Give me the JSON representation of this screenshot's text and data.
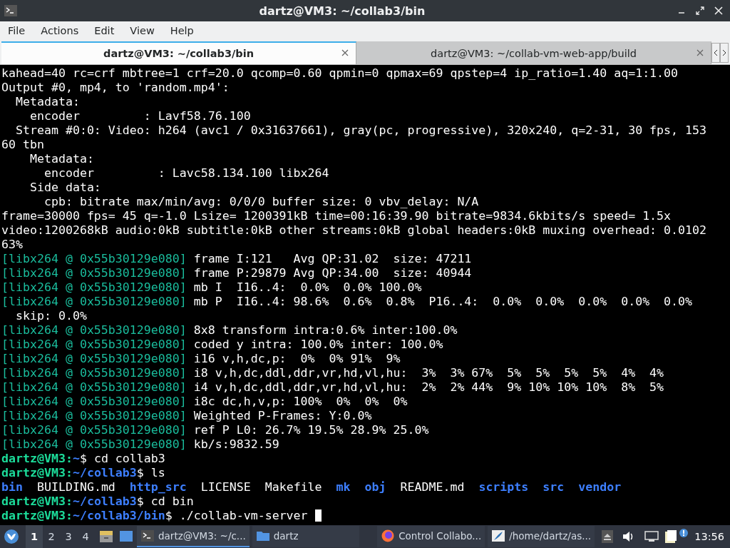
{
  "window": {
    "title": "dartz@VM3: ~/collab3/bin"
  },
  "menu": [
    "File",
    "Actions",
    "Edit",
    "View",
    "Help"
  ],
  "tabs": [
    {
      "label": "dartz@VM3: ~/collab3/bin",
      "selected": true
    },
    {
      "label": "dartz@VM3: ~/collab-vm-web-app/build",
      "selected": false
    }
  ],
  "terminal": {
    "lines": [
      [
        {
          "kind": "text",
          "text": "kahead=40 rc=crf mbtree=1 crf=20.0 qcomp=0.60 qpmin=0 qpmax=69 qpstep=4 ip_ratio=1.40 aq=1:1.00"
        }
      ],
      [
        {
          "kind": "text",
          "text": "Output #0, mp4, to 'random.mp4':"
        }
      ],
      [
        {
          "kind": "text",
          "text": "  Metadata:"
        }
      ],
      [
        {
          "kind": "text",
          "text": "    encoder         : Lavf58.76.100"
        }
      ],
      [
        {
          "kind": "text",
          "text": "  Stream #0:0: Video: h264 (avc1 / 0x31637661), gray(pc, progressive), 320x240, q=2-31, 30 fps, 153"
        }
      ],
      [
        {
          "kind": "text",
          "text": "60 tbn"
        }
      ],
      [
        {
          "kind": "text",
          "text": "    Metadata:"
        }
      ],
      [
        {
          "kind": "text",
          "text": "      encoder         : Lavc58.134.100 libx264"
        }
      ],
      [
        {
          "kind": "text",
          "text": "    Side data:"
        }
      ],
      [
        {
          "kind": "text",
          "text": "      cpb: bitrate max/min/avg: 0/0/0 buffer size: 0 vbv_delay: N/A"
        }
      ],
      [
        {
          "kind": "text",
          "text": "frame=30000 fps= 45 q=-1.0 Lsize= 1200391kB time=00:16:39.90 bitrate=9834.6kbits/s speed= 1.5x"
        }
      ],
      [
        {
          "kind": "text",
          "text": "video:1200268kB audio:0kB subtitle:0kB other streams:0kB global headers:0kB muxing overhead: 0.0102"
        }
      ],
      [
        {
          "kind": "text",
          "text": "63%"
        }
      ],
      [
        {
          "kind": "prefix",
          "text": "[libx264 @ 0x55b30129e080]"
        },
        {
          "kind": "text",
          "text": " frame I:121   Avg QP:31.02  size: 47211"
        }
      ],
      [
        {
          "kind": "prefix",
          "text": "[libx264 @ 0x55b30129e080]"
        },
        {
          "kind": "text",
          "text": " frame P:29879 Avg QP:34.00  size: 40944"
        }
      ],
      [
        {
          "kind": "prefix",
          "text": "[libx264 @ 0x55b30129e080]"
        },
        {
          "kind": "text",
          "text": " mb I  I16..4:  0.0%  0.0% 100.0%"
        }
      ],
      [
        {
          "kind": "prefix",
          "text": "[libx264 @ 0x55b30129e080]"
        },
        {
          "kind": "text",
          "text": " mb P  I16..4: 98.6%  0.6%  0.8%  P16..4:  0.0%  0.0%  0.0%  0.0%  0.0%"
        }
      ],
      [
        {
          "kind": "text",
          "text": "  skip: 0.0%"
        }
      ],
      [
        {
          "kind": "prefix",
          "text": "[libx264 @ 0x55b30129e080]"
        },
        {
          "kind": "text",
          "text": " 8x8 transform intra:0.6% inter:100.0%"
        }
      ],
      [
        {
          "kind": "prefix",
          "text": "[libx264 @ 0x55b30129e080]"
        },
        {
          "kind": "text",
          "text": " coded y intra: 100.0% inter: 100.0%"
        }
      ],
      [
        {
          "kind": "prefix",
          "text": "[libx264 @ 0x55b30129e080]"
        },
        {
          "kind": "text",
          "text": " i16 v,h,dc,p:  0%  0% 91%  9%"
        }
      ],
      [
        {
          "kind": "prefix",
          "text": "[libx264 @ 0x55b30129e080]"
        },
        {
          "kind": "text",
          "text": " i8 v,h,dc,ddl,ddr,vr,hd,vl,hu:  3%  3% 67%  5%  5%  5%  5%  4%  4%"
        }
      ],
      [
        {
          "kind": "prefix",
          "text": "[libx264 @ 0x55b30129e080]"
        },
        {
          "kind": "text",
          "text": " i4 v,h,dc,ddl,ddr,vr,hd,vl,hu:  2%  2% 44%  9% 10% 10% 10%  8%  5%"
        }
      ],
      [
        {
          "kind": "prefix",
          "text": "[libx264 @ 0x55b30129e080]"
        },
        {
          "kind": "text",
          "text": " i8c dc,h,v,p: 100%  0%  0%  0%"
        }
      ],
      [
        {
          "kind": "prefix",
          "text": "[libx264 @ 0x55b30129e080]"
        },
        {
          "kind": "text",
          "text": " Weighted P-Frames: Y:0.0%"
        }
      ],
      [
        {
          "kind": "prefix",
          "text": "[libx264 @ 0x55b30129e080]"
        },
        {
          "kind": "text",
          "text": " ref P L0: 26.7% 19.5% 28.9% 25.0%"
        }
      ],
      [
        {
          "kind": "prefix",
          "text": "[libx264 @ 0x55b30129e080]"
        },
        {
          "kind": "text",
          "text": " kb/s:9832.59"
        }
      ],
      [
        {
          "kind": "user",
          "text": "dartz@VM3:"
        },
        {
          "kind": "path",
          "text": "~"
        },
        {
          "kind": "text",
          "text": "$ cd collab3"
        }
      ],
      [
        {
          "kind": "user",
          "text": "dartz@VM3:"
        },
        {
          "kind": "path",
          "text": "~/collab3"
        },
        {
          "kind": "text",
          "text": "$ ls"
        }
      ],
      [
        {
          "kind": "dir",
          "text": "bin"
        },
        {
          "kind": "text",
          "text": "  BUILDING.md  "
        },
        {
          "kind": "dir",
          "text": "http_src"
        },
        {
          "kind": "text",
          "text": "  LICENSE  Makefile  "
        },
        {
          "kind": "dir",
          "text": "mk  obj"
        },
        {
          "kind": "text",
          "text": "  README.md  "
        },
        {
          "kind": "dir",
          "text": "scripts  src  vendor"
        }
      ],
      [
        {
          "kind": "user",
          "text": "dartz@VM3:"
        },
        {
          "kind": "path",
          "text": "~/collab3"
        },
        {
          "kind": "text",
          "text": "$ cd bin"
        }
      ],
      [
        {
          "kind": "user",
          "text": "dartz@VM3:"
        },
        {
          "kind": "path",
          "text": "~/collab3/bin"
        },
        {
          "kind": "text",
          "text": "$ ./collab-vm-server "
        },
        {
          "kind": "cursor"
        }
      ]
    ]
  },
  "taskbar": {
    "workspaces": [
      {
        "label": "1",
        "selected": true
      },
      {
        "label": "2",
        "selected": false
      },
      {
        "label": "3",
        "selected": false
      },
      {
        "label": "4",
        "selected": false
      }
    ],
    "tasks": [
      {
        "kind": "terminal",
        "label": "dartz@VM3: ~/c...",
        "selected": true
      },
      {
        "kind": "folder",
        "label": "dartz",
        "selected": false
      },
      {
        "kind": "browser",
        "label": "Control Collabo...",
        "selected": false
      },
      {
        "kind": "editor",
        "label": "/home/dartz/as...",
        "selected": false
      }
    ],
    "clock": "13:56"
  }
}
